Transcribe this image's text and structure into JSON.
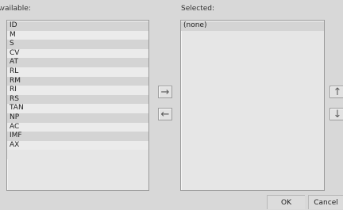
{
  "available": {
    "label": "Available:",
    "items": [
      "ID",
      "M",
      "S",
      "CV",
      "AT",
      "RL",
      "RM",
      "RI",
      "RS",
      "TAN",
      "NP",
      "AC",
      "IMF",
      "AX"
    ]
  },
  "selected": {
    "label": "Selected:",
    "items": [
      "(none)"
    ]
  },
  "buttons": {
    "add_icon": "right-arrow",
    "remove_icon": "left-arrow",
    "move_up_icon": "up-arrow",
    "move_down_icon": "down-arrow",
    "ok_label": "OK",
    "cancel_label": "Cancel"
  }
}
